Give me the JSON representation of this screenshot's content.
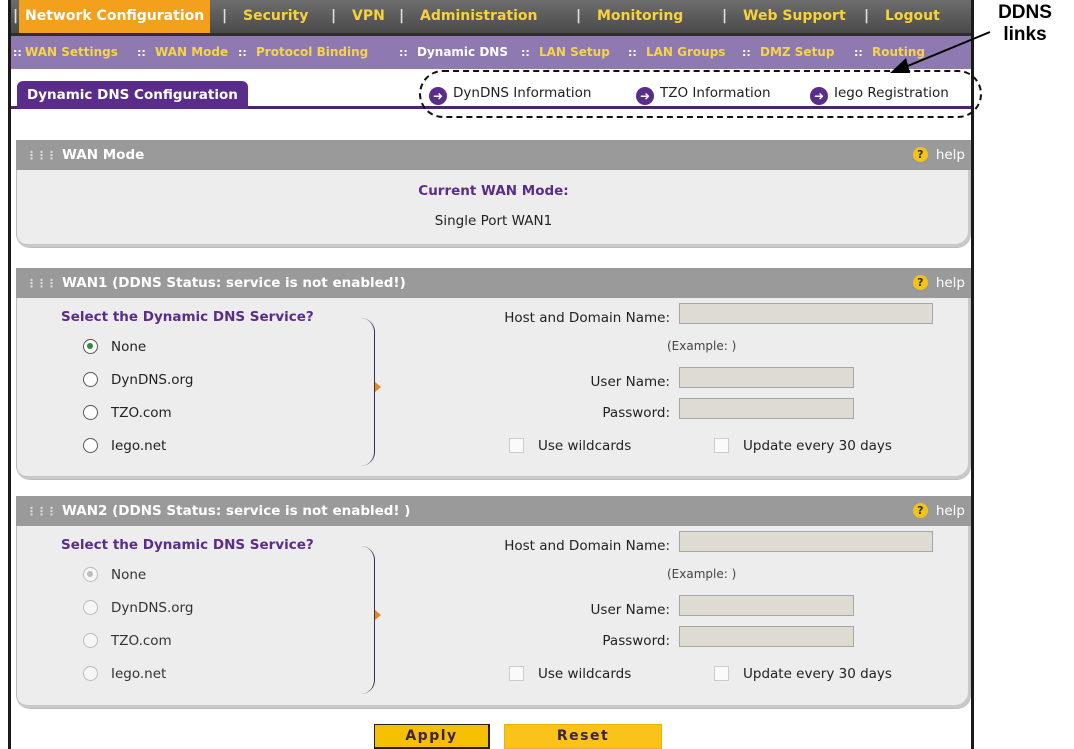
{
  "topnav": {
    "items": [
      "Network Configuration",
      "Security",
      "VPN",
      "Administration",
      "Monitoring",
      "Web Support",
      "Logout"
    ],
    "separator": "|"
  },
  "subnav": {
    "items": [
      "WAN Settings",
      "WAN Mode",
      "Protocol Binding",
      "Dynamic DNS",
      "LAN Setup",
      "LAN Groups",
      "DMZ Setup",
      "Routing"
    ],
    "separator": "::",
    "active": "Dynamic DNS"
  },
  "page": {
    "tab_title": "Dynamic DNS Configuration",
    "links": [
      "DynDNS Information",
      "TZO Information",
      "Iego Registration"
    ]
  },
  "callout": {
    "line1": "DDNS",
    "line2": "links"
  },
  "wan_mode": {
    "header": "WAN Mode",
    "help": "help",
    "current_label": "Current WAN Mode:",
    "current_value": "Single Port WAN1"
  },
  "wan1": {
    "header": "WAN1 (DDNS Status: service is not enabled!)",
    "help": "help",
    "service_title": "Select the Dynamic DNS Service?",
    "options": [
      "None",
      "DynDNS.org",
      "TZO.com",
      "Iego.net"
    ],
    "selected": "None",
    "host_label": "Host and Domain Name:",
    "example": "(Example: )",
    "user_label": "User Name:",
    "password_label": "Password:",
    "wildcards_label": "Use wildcards",
    "update_label": "Update every 30 days"
  },
  "wan2": {
    "header": "WAN2 (DDNS Status: service is not enabled! )",
    "help": "help",
    "service_title": "Select the Dynamic DNS Service?",
    "options": [
      "None",
      "DynDNS.org",
      "TZO.com",
      "Iego.net"
    ],
    "selected": "None",
    "host_label": "Host and Domain Name:",
    "example": "(Example: )",
    "user_label": "User Name:",
    "password_label": "Password:",
    "wildcards_label": "Use wildcards",
    "update_label": "Update every 30 days"
  },
  "buttons": {
    "apply": "Apply",
    "reset": "Reset"
  },
  "colors": {
    "accent": "#5a2d8a",
    "nav_highlight": "#f3a01c",
    "nav_text": "#f8d23a",
    "button": "#f5c000"
  },
  "icons": [
    "arrow-circle-icon",
    "help-icon",
    "grip-icon",
    "brace-arrow-icon"
  ]
}
